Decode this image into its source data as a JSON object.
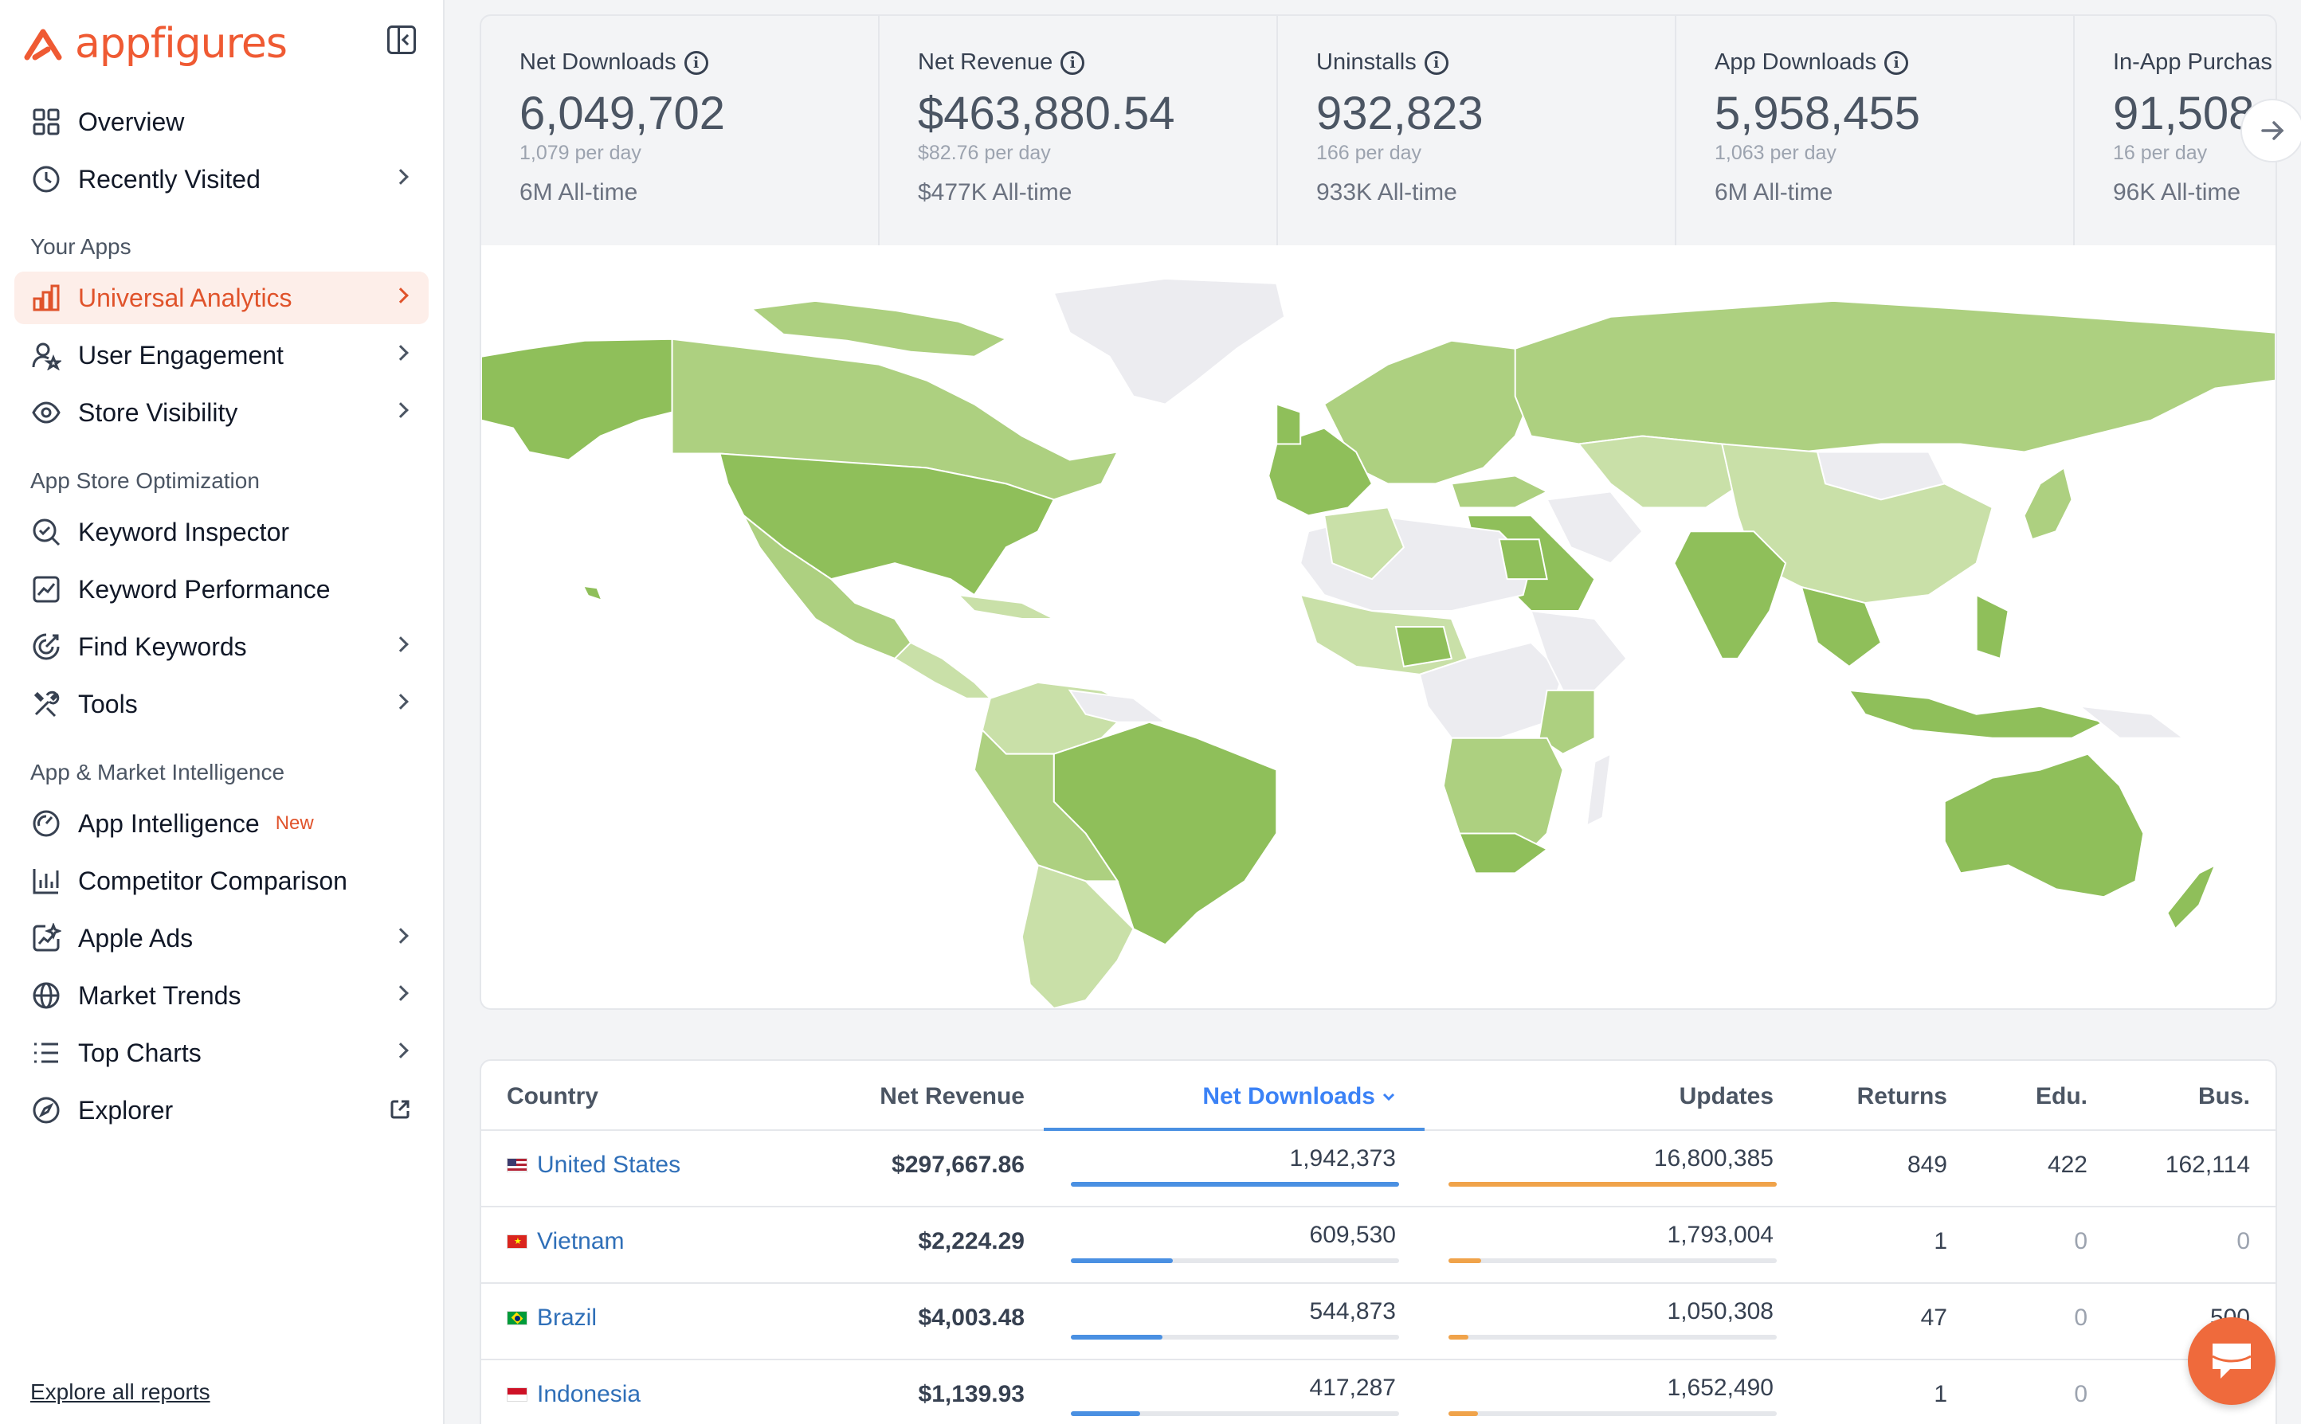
{
  "app": {
    "brand": "appfigures",
    "brand_color": "#ef5a33"
  },
  "sidebar": {
    "top_items": [
      {
        "label": "Overview",
        "icon": "grid-icon"
      },
      {
        "label": "Recently Visited",
        "icon": "clock-icon"
      }
    ],
    "sections": [
      {
        "title": "Your Apps",
        "items": [
          {
            "label": "Universal Analytics",
            "icon": "bar-chart-icon",
            "active": true
          },
          {
            "label": "User Engagement",
            "icon": "user-star-icon"
          },
          {
            "label": "Store Visibility",
            "icon": "eye-icon"
          }
        ]
      },
      {
        "title": "App Store Optimization",
        "items": [
          {
            "label": "Keyword Inspector",
            "icon": "search-check-icon"
          },
          {
            "label": "Keyword Performance",
            "icon": "chart-line-icon"
          },
          {
            "label": "Find Keywords",
            "icon": "target-icon"
          },
          {
            "label": "Tools",
            "icon": "tools-icon"
          }
        ]
      },
      {
        "title": "App & Market Intelligence",
        "items": [
          {
            "label": "App Intelligence",
            "icon": "gauge-icon",
            "badge": "New"
          },
          {
            "label": "Competitor Comparison",
            "icon": "compare-icon"
          },
          {
            "label": "Apple Ads",
            "icon": "sparkle-chart-icon"
          },
          {
            "label": "Market Trends",
            "icon": "globe-icon"
          },
          {
            "label": "Top Charts",
            "icon": "list-icon"
          },
          {
            "label": "Explorer",
            "icon": "compass-icon"
          }
        ]
      }
    ],
    "explore_link": "Explore all reports"
  },
  "stats": [
    {
      "label": "Net Downloads",
      "value": "6,049,702",
      "per_day": "1,079 per day",
      "all_time": "6M All-time"
    },
    {
      "label": "Net Revenue",
      "value": "$463,880.54",
      "per_day": "$82.76 per day",
      "all_time": "$477K All-time"
    },
    {
      "label": "Uninstalls",
      "value": "932,823",
      "per_day": "166 per day",
      "all_time": "933K All-time"
    },
    {
      "label": "App Downloads",
      "value": "5,958,455",
      "per_day": "1,063 per day",
      "all_time": "6M All-time"
    },
    {
      "label": "In-App Purchas",
      "value": "91,508",
      "per_day": "16 per day",
      "all_time": "96K All-time"
    }
  ],
  "table": {
    "headers": {
      "country": "Country",
      "net_revenue": "Net Revenue",
      "net_downloads": "Net Downloads",
      "updates": "Updates",
      "returns": "Returns",
      "edu": "Edu.",
      "bus": "Bus."
    },
    "rows": [
      {
        "country": "United States",
        "net_revenue": "$297,667.86",
        "net_downloads": "1,942,373",
        "dl_fraction": 1.0,
        "updates": "16,800,385",
        "up_fraction": 1.0,
        "returns": "849",
        "edu": "422",
        "bus": "162,114"
      },
      {
        "country": "Vietnam",
        "net_revenue": "$2,224.29",
        "net_downloads": "609,530",
        "dl_fraction": 0.31,
        "updates": "1,793,004",
        "up_fraction": 0.1,
        "returns": "1",
        "edu": "0",
        "bus": "0"
      },
      {
        "country": "Brazil",
        "net_revenue": "$4,003.48",
        "net_downloads": "544,873",
        "dl_fraction": 0.28,
        "updates": "1,050,308",
        "up_fraction": 0.06,
        "returns": "47",
        "edu": "0",
        "bus": "500"
      },
      {
        "country": "Indonesia",
        "net_revenue": "$1,139.93",
        "net_downloads": "417,287",
        "dl_fraction": 0.21,
        "updates": "1,652,490",
        "up_fraction": 0.09,
        "returns": "1",
        "edu": "0",
        "bus": ""
      }
    ]
  },
  "colors": {
    "accent": "#e0532b",
    "link": "#2f6fb8",
    "sorted_header": "#3b82f6",
    "downloads_bar": "#4a90e2",
    "updates_bar": "#f0a34a",
    "map_dark": "#8fbf5a",
    "map_mid": "#add080",
    "map_light": "#c9e0a8",
    "map_none": "#ececf0"
  }
}
